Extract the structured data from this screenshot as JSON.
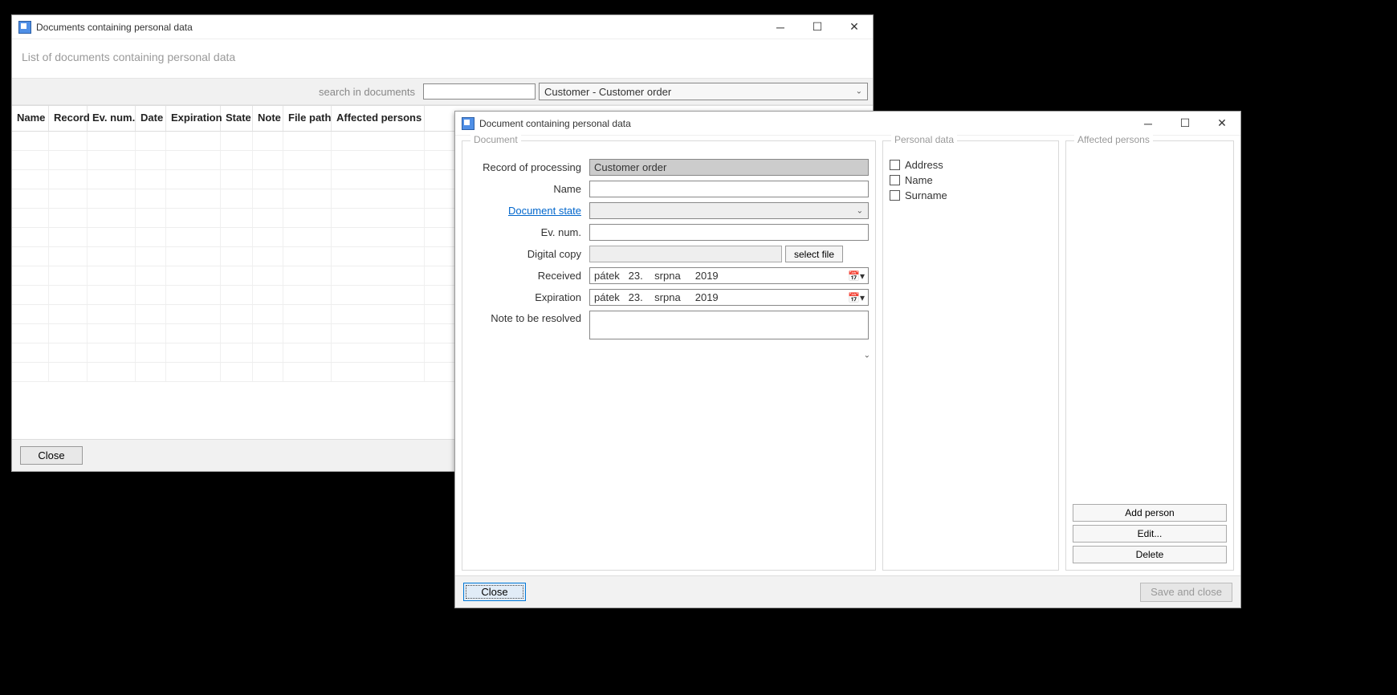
{
  "win1": {
    "title": "Documents containing personal data",
    "subtitle": "List of documents containing personal data",
    "search_label": "search in documents",
    "search_value": "",
    "search_select": "Customer - Customer order",
    "columns": [
      "Name",
      "Record",
      "Ev. num.",
      "Date",
      "Expiration",
      "State",
      "Note",
      "File path",
      "Affected persons"
    ],
    "close_label": "Close"
  },
  "win2": {
    "title": "Document containing personal data",
    "group_doc": "Document",
    "group_pd": "Personal data",
    "group_aff": "Affected persons",
    "labels": {
      "record": "Record of processing",
      "name": "Name",
      "doc_state": "Document state",
      "ev_num": "Ev. num.",
      "digital_copy": "Digital copy",
      "received": "Received",
      "expiration": "Expiration",
      "note": "Note to be resolved"
    },
    "values": {
      "record": "Customer order",
      "name": "",
      "doc_state": "",
      "ev_num": "",
      "digital_copy": "",
      "received": "pátek   23.    srpna     2019",
      "expiration": "pátek   23.    srpna     2019",
      "note": ""
    },
    "select_file_label": "select file",
    "pd_items": [
      "Address",
      "Name",
      "Surname"
    ],
    "aff_buttons": {
      "add": "Add person",
      "edit": "Edit...",
      "delete": "Delete"
    },
    "close_label": "Close",
    "save_close_label": "Save and close"
  }
}
